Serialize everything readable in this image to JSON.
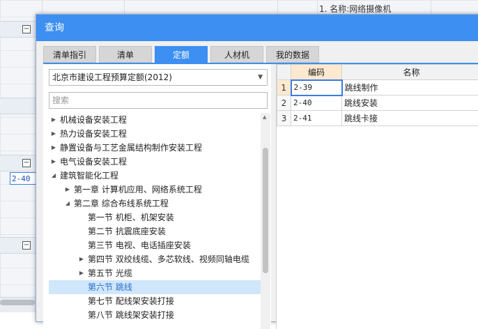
{
  "background": {
    "top_text": "1. 名称:网络摄像机",
    "selected_cell": "2-40"
  },
  "dialog": {
    "title": "查询",
    "tabs": [
      {
        "label": "清单指引",
        "active": false
      },
      {
        "label": "清单",
        "active": false
      },
      {
        "label": "定额",
        "active": true
      },
      {
        "label": "人材机",
        "active": false
      },
      {
        "label": "我的数据",
        "active": false
      }
    ],
    "quota_select": "北京市建设工程预算定额(2012)",
    "search": {
      "placeholder": "搜索",
      "value": ""
    },
    "tree": [
      {
        "label": "机械设备安装工程",
        "level": 0,
        "toggle": "collapsed"
      },
      {
        "label": "热力设备安装工程",
        "level": 0,
        "toggle": "collapsed"
      },
      {
        "label": "静置设备与工艺金属结构制作安装工程",
        "level": 0,
        "toggle": "collapsed"
      },
      {
        "label": "电气设备安装工程",
        "level": 0,
        "toggle": "collapsed"
      },
      {
        "label": "建筑智能化工程",
        "level": 0,
        "toggle": "expanded"
      },
      {
        "label": "第一章 计算机应用、网络系统工程",
        "level": 1,
        "toggle": "collapsed"
      },
      {
        "label": "第二章 综合布线系统工程",
        "level": 1,
        "toggle": "expanded"
      },
      {
        "label": "第一节 机柜、机架安装",
        "level": 2,
        "toggle": "none"
      },
      {
        "label": "第二节 抗震底座安装",
        "level": 2,
        "toggle": "none"
      },
      {
        "label": "第三节 电视、电话插座安装",
        "level": 2,
        "toggle": "none"
      },
      {
        "label": "第四节 双绞线缆、多芯软线、视频同轴电缆",
        "level": 2,
        "toggle": "collapsed"
      },
      {
        "label": "第五节 光缆",
        "level": 2,
        "toggle": "collapsed"
      },
      {
        "label": "第六节 跳线",
        "level": 2,
        "toggle": "none",
        "selected": true
      },
      {
        "label": "第七节 配线架安装打接",
        "level": 2,
        "toggle": "none"
      },
      {
        "label": "第八节 跳线架安装打接",
        "level": 2,
        "toggle": "none"
      }
    ],
    "grid": {
      "headers": [
        "编码",
        "名称"
      ],
      "rows": [
        {
          "index": "1",
          "code": "2-39",
          "name": "跳线制作"
        },
        {
          "index": "2",
          "code": "2-40",
          "name": "跳线安装"
        },
        {
          "index": "3",
          "code": "2-41",
          "name": "跳线卡接"
        }
      ]
    }
  },
  "colors": {
    "accent": "#3d8ff2",
    "selection": "#cfe6fb",
    "header_highlight": "#fde9cf"
  },
  "icons": {
    "expanded": "triangle-down-icon",
    "collapsed": "triangle-right-icon",
    "dropdown": "chevron-down-icon"
  }
}
